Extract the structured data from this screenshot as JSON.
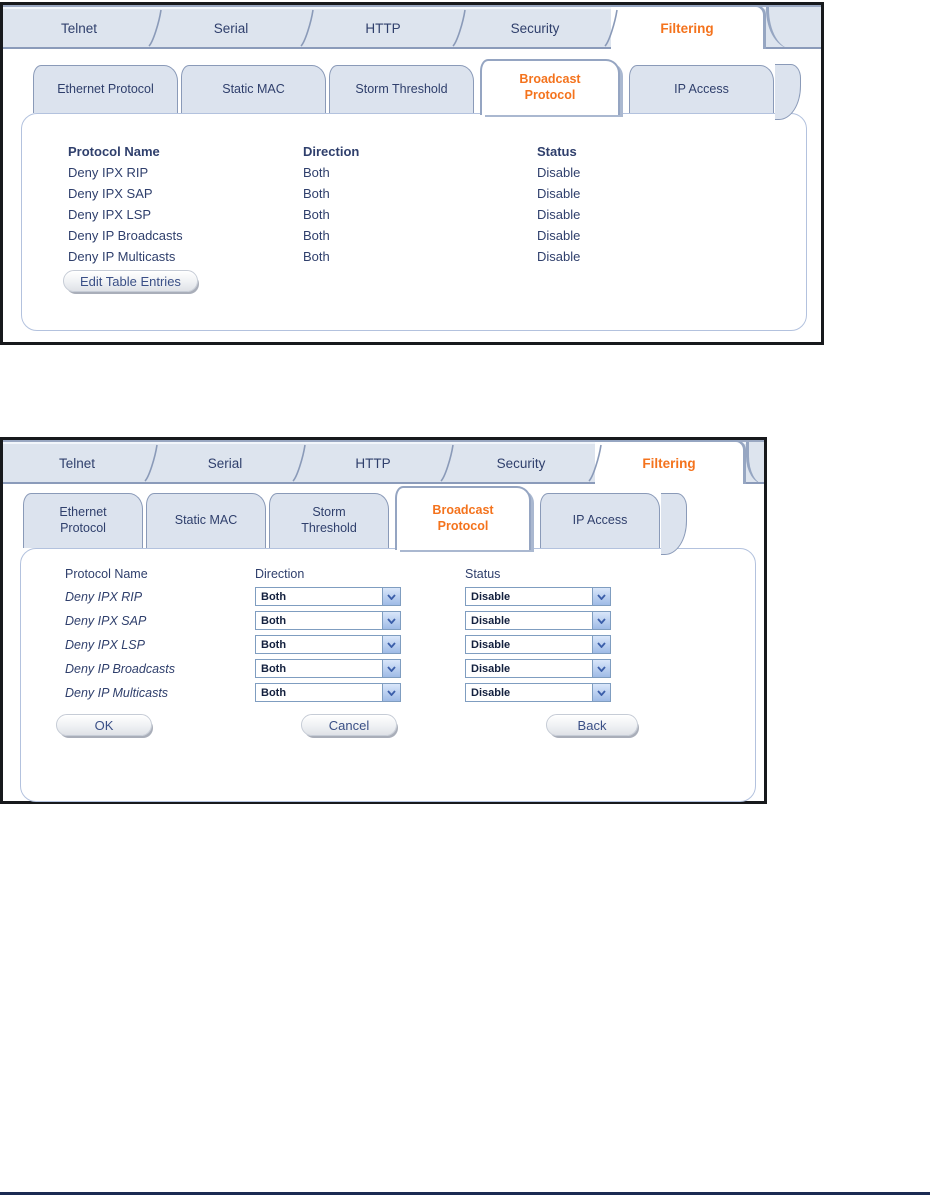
{
  "tabs": {
    "main": [
      {
        "label": "Telnet",
        "active": false
      },
      {
        "label": "Serial",
        "active": false
      },
      {
        "label": "HTTP",
        "active": false
      },
      {
        "label": "Security",
        "active": false
      },
      {
        "label": "Filtering",
        "active": true
      }
    ],
    "sub": [
      {
        "label": "Ethernet Protocol",
        "active": false
      },
      {
        "label": "Static MAC",
        "active": false
      },
      {
        "label": "Storm Threshold",
        "active": false
      },
      {
        "label": "Broadcast Protocol",
        "active": true
      },
      {
        "label": "IP Access",
        "active": false
      }
    ]
  },
  "table_view": {
    "columns": [
      "Protocol Name",
      "Direction",
      "Status"
    ],
    "rows": [
      {
        "name": "Deny IPX RIP",
        "direction": "Both",
        "status": "Disable"
      },
      {
        "name": "Deny IPX SAP",
        "direction": "Both",
        "status": "Disable"
      },
      {
        "name": "Deny IPX LSP",
        "direction": "Both",
        "status": "Disable"
      },
      {
        "name": "Deny IP Broadcasts",
        "direction": "Both",
        "status": "Disable"
      },
      {
        "name": "Deny IP Multicasts",
        "direction": "Both",
        "status": "Disable"
      }
    ],
    "edit_button": "Edit Table Entries"
  },
  "edit_view": {
    "columns": [
      "Protocol Name",
      "Direction",
      "Status"
    ],
    "rows": [
      {
        "name": "Deny IPX RIP",
        "direction": "Both",
        "status": "Disable"
      },
      {
        "name": "Deny IPX SAP",
        "direction": "Both",
        "status": "Disable"
      },
      {
        "name": "Deny IPX LSP",
        "direction": "Both",
        "status": "Disable"
      },
      {
        "name": "Deny IP Broadcasts",
        "direction": "Both",
        "status": "Disable"
      },
      {
        "name": "Deny IP Multicasts",
        "direction": "Both",
        "status": "Disable"
      }
    ],
    "buttons": {
      "ok": "OK",
      "cancel": "Cancel",
      "back": "Back"
    }
  },
  "colors": {
    "accent_orange": "#f4731d",
    "tab_fill": "#dde4ee",
    "tab_border": "#8a9ab8",
    "text_navy": "#2f3f6c",
    "panel_frame": "#17191c",
    "box_border": "#b3c2de",
    "combo_border": "#7f9dc0",
    "footer_rule": "#1b2a52"
  }
}
